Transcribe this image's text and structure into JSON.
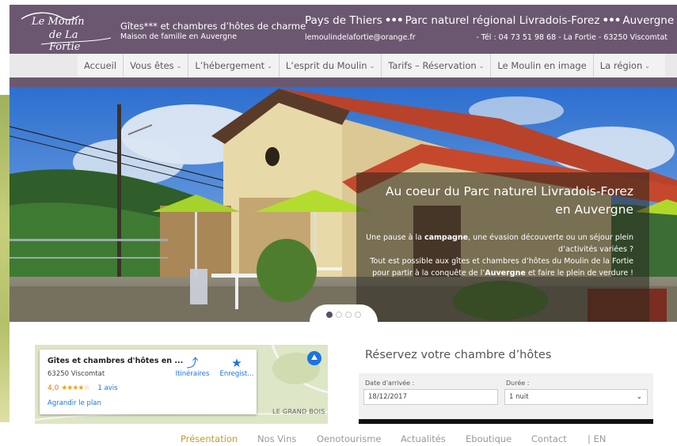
{
  "header": {
    "logo_line1": "Le Moulin",
    "logo_line2": "de La Fortie",
    "tagline_main": "Gîtes*** et chambres d’hôtes de charme",
    "tagline_sub": "Maison de famille en Auvergne",
    "region_part1": "Pays de Thiers",
    "region_part2": "Parc naturel régional Livradois-Forez",
    "region_part3": "Auvergne",
    "region_separator": "•••",
    "email": "lemoulindelafortie@orange.fr",
    "contact": "- Tél : 04 73 51 98 68 - La Fortie - 63250 Viscomtat"
  },
  "nav": {
    "items": [
      {
        "label": "Accueil",
        "dropdown": false
      },
      {
        "label": "Vous êtes",
        "dropdown": true
      },
      {
        "label": "L’hébergement",
        "dropdown": true
      },
      {
        "label": "L’esprit du Moulin",
        "dropdown": true
      },
      {
        "label": "Tarifs – Réservation",
        "dropdown": true
      },
      {
        "label": "Le Moulin en image",
        "dropdown": false
      },
      {
        "label": "La région",
        "dropdown": true
      }
    ],
    "caret": "⌄"
  },
  "hero": {
    "title_line1": "Au coeur du Parc naturel Livradois-Forez",
    "title_line2": "en Auvergne",
    "text_1": "Une pause à la ",
    "text_1b": "campagne",
    "text_2": ", une évasion découverte ou un séjour plein d’activités variées ?",
    "text_3": "Tout est possible aux gîtes et chambres d’hôtes du Moulin de la Fortie pour partir à la conquête de l’",
    "text_3b": "Auvergne",
    "text_4": " et faire le plein de verdure !",
    "slides": 4,
    "active_slide": 1
  },
  "map": {
    "title": "Gîtes et chambres d'hôtes en ...",
    "address": "63250 Viscomtat",
    "rating_value": "4,0",
    "stars": "★★★★☆",
    "reviews": "1 avis",
    "enlarge": "Agrandir le plan",
    "directions": "Itinéraires",
    "save": "Enregist...",
    "place_label": "LE GRAND BOIS"
  },
  "booking": {
    "title": "Réservez votre chambre d’hôtes",
    "arrival_label": "Date d'arrivée :",
    "arrival_value": "18/12/2017",
    "duration_label": "Durée :",
    "duration_value": "1 nuit"
  },
  "footer_nav": {
    "items": [
      "Présentation",
      "Nos Vins",
      "Oenotourisme",
      "Actualités",
      "Eboutique",
      "Contact",
      "| EN"
    ],
    "active": "Présentation"
  },
  "colors": {
    "header_bg": "#6b5870",
    "accent_gold": "#c39a2c",
    "link_blue": "#1a73e8"
  }
}
